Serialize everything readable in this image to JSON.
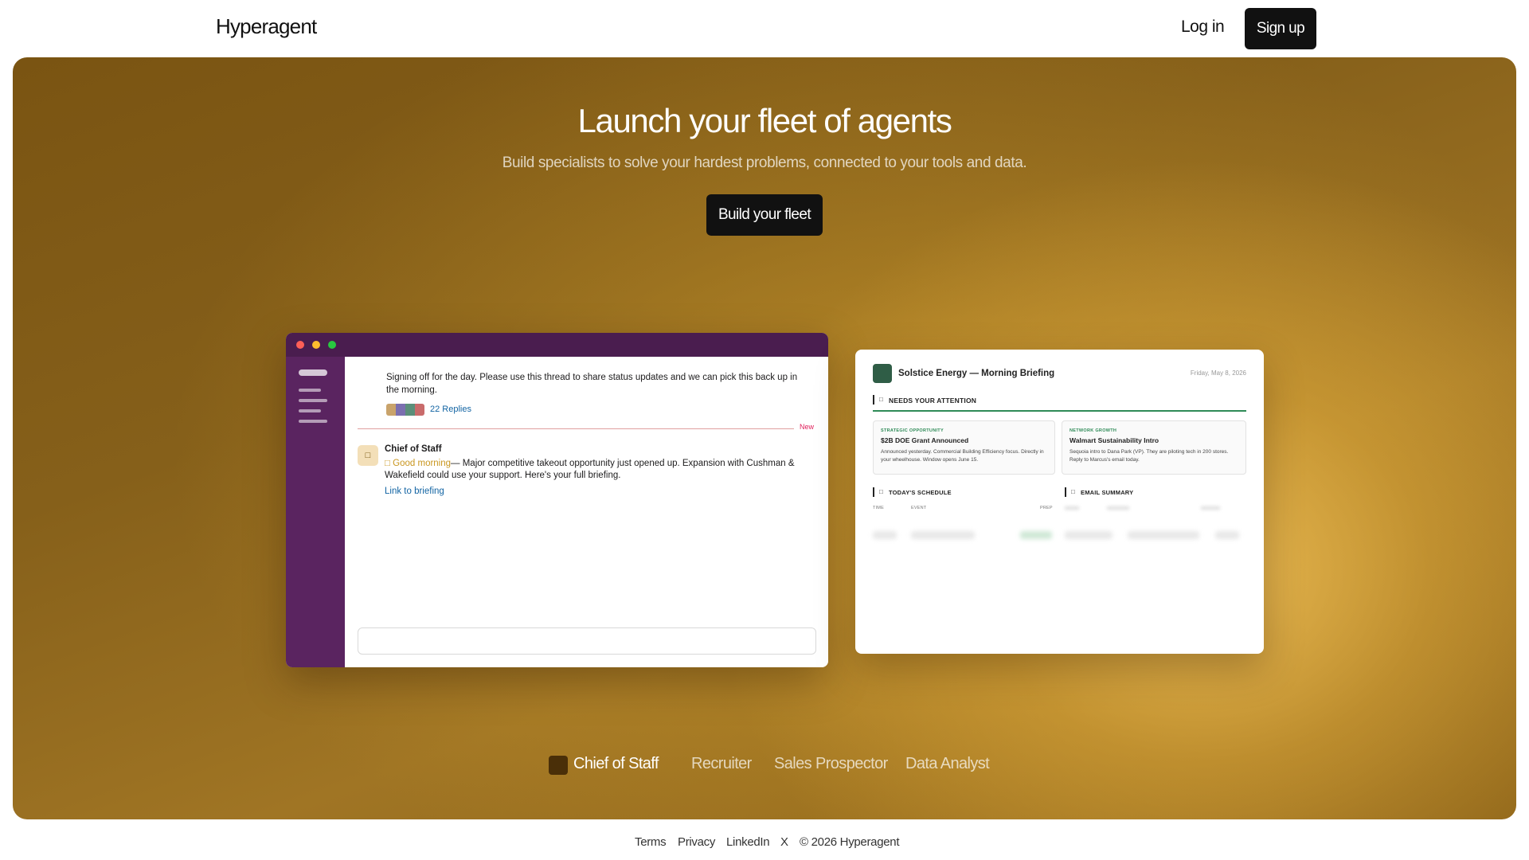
{
  "nav": {
    "logo": "Hyperagent",
    "login": "Log in",
    "signup": "Sign up"
  },
  "hero": {
    "title": "Launch your fleet of agents",
    "subtitle": "Build specialists to solve your hardest problems, connected to your tools and data.",
    "cta": "Build your fleet"
  },
  "slack": {
    "message_1": "Signing off for the day. Please use this thread to share status updates and we can pick this back up in the morning.",
    "replies": "22 Replies",
    "new_label": "New",
    "sender": "Chief of Staff",
    "greeting": "Good morning",
    "message_2": "— Major competitive takeout opportunity just opened up. Expansion with Cushman & Wakefield could use your support. Here's your full briefing.",
    "link": "Link to briefing",
    "colors": {
      "titlebar": "#4a1d4f",
      "sidebar": "#5a2460",
      "link": "#1264a3"
    }
  },
  "briefing": {
    "title": "Solstice Energy — Morning Briefing",
    "date": "Friday, May 8, 2026",
    "needs_attention": "NEEDS YOUR ATTENTION",
    "cards": [
      {
        "tag": "STRATEGIC OPPORTUNITY",
        "title": "$2B DOE Grant Announced",
        "body": "Announced yesterday. Commercial Building Efficiency focus. Directly in your wheelhouse. Window opens June 15."
      },
      {
        "tag": "NETWORK GROWTH",
        "title": "Walmart Sustainability Intro",
        "body": "Sequoia intro to Dana Park (VP). They are piloting tech in 200 stores. Reply to Marcus's email today."
      }
    ],
    "schedule": {
      "title": "TODAY'S SCHEDULE",
      "columns": [
        "TIME",
        "EVENT",
        "PREP"
      ]
    },
    "email": {
      "title": "EMAIL SUMMARY"
    }
  },
  "agents": {
    "items": [
      "Chief of Staff",
      "Recruiter",
      "Sales Prospector",
      "Data Analyst"
    ],
    "active": "Chief of Staff"
  },
  "footer": {
    "links": [
      "Terms",
      "Privacy",
      "LinkedIn",
      "X"
    ],
    "copyright": "© 2026 Hyperagent"
  }
}
